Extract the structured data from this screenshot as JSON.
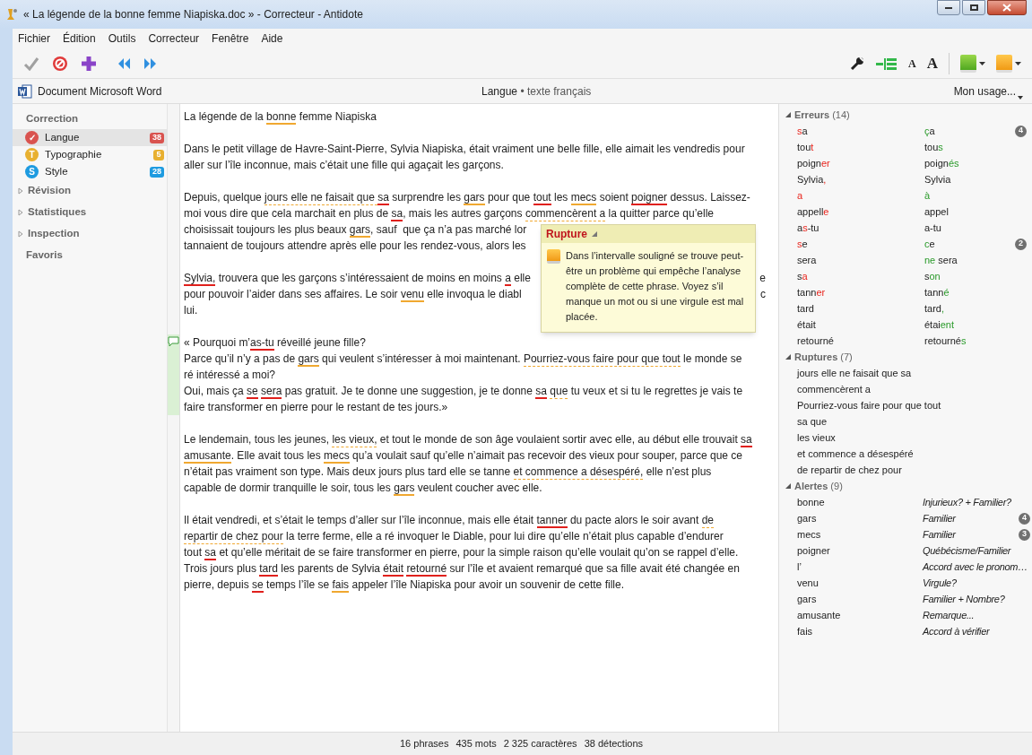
{
  "window": {
    "title": "« La légende de la bonne femme Niapiska.doc » - Correcteur - Antidote"
  },
  "menu": [
    {
      "label": "Fichier"
    },
    {
      "label": "Édition"
    },
    {
      "label": "Outils"
    },
    {
      "label": "Correcteur"
    },
    {
      "label": "Fenêtre"
    },
    {
      "label": "Aide"
    }
  ],
  "toolbar": {
    "font_buttons": [
      "A",
      "A"
    ]
  },
  "doc_bar": {
    "document": "Document Microsoft Word",
    "prism": "Langue",
    "separator": "•",
    "language": "texte français",
    "usage": "Mon usage..."
  },
  "sidebar": [
    {
      "label": "Correction",
      "kind": "group",
      "items": [
        {
          "label": "Langue",
          "symbol": "✓",
          "count": "38",
          "color": "#d9534f",
          "selected": true
        },
        {
          "label": "Typographie",
          "symbol": "T",
          "count": "5",
          "color": "#e8b030",
          "selected": false
        },
        {
          "label": "Style",
          "symbol": "S",
          "count": "28",
          "color": "#1e9be0",
          "selected": false
        }
      ]
    },
    {
      "label": "Révision",
      "kind": "collapsible",
      "expanded": false
    },
    {
      "label": "Statistiques",
      "kind": "collapsible",
      "expanded": false
    },
    {
      "label": "Inspection",
      "kind": "collapsible",
      "expanded": false
    },
    {
      "label": "Favoris",
      "kind": "plain"
    }
  ],
  "document": {
    "paragraphs": [
      {
        "comment": false,
        "lines": [
          [
            {
              "text": "La légende de la ",
              "kind": "plain"
            },
            {
              "text": "bonne",
              "kind": "alert"
            },
            {
              "text": " femme Niapiska",
              "kind": "plain"
            }
          ]
        ]
      },
      {
        "comment": false,
        "lines": [
          [
            {
              "text": "Dans le petit village de Havre-Saint-Pierre, Sylvia Niapiska, était vraiment une belle fille, elle aimait les vendredis pour",
              "kind": "plain"
            }
          ],
          [
            {
              "text": "aller sur l’île inconnue, mais c’était une fille qui agaçait les garçons.",
              "kind": "plain"
            }
          ]
        ]
      },
      {
        "comment": false,
        "lines": [
          [
            {
              "text": "Depuis, quelque ",
              "kind": "plain"
            },
            {
              "text": "jours elle ne faisait que ",
              "kind": "rupture"
            },
            {
              "text": "sa",
              "kind": "rupture_error"
            },
            {
              "text": " surprendre les ",
              "kind": "plain"
            },
            {
              "text": "gars",
              "kind": "alert"
            },
            {
              "text": " pour que ",
              "kind": "plain"
            },
            {
              "text": "tout",
              "kind": "error"
            },
            {
              "text": " les ",
              "kind": "plain"
            },
            {
              "text": "mecs",
              "kind": "alert"
            },
            {
              "text": " soient ",
              "kind": "plain"
            },
            {
              "text": "poigner",
              "kind": "error"
            },
            {
              "text": " dessus. Laissez-",
              "kind": "plain"
            }
          ],
          [
            {
              "text": "moi vous dire que cela marchait en plus de ",
              "kind": "plain"
            },
            {
              "text": "sa",
              "kind": "error"
            },
            {
              "text": ", mais les autres garçons ",
              "kind": "plain"
            },
            {
              "text": "commencèrent a",
              "kind": "rupture"
            },
            {
              "text": " la quitter parce qu’elle",
              "kind": "plain"
            }
          ],
          [
            {
              "text": "choisissait toujours les plus beaux ",
              "kind": "plain"
            },
            {
              "text": "gars",
              "kind": "alert"
            },
            {
              "text": ", sauf  que ça n’a pas marché lor",
              "kind": "plain"
            }
          ],
          [
            {
              "text": "tannaient de toujours attendre après elle pour les rendez-vous, alors les",
              "kind": "plain"
            }
          ]
        ]
      },
      {
        "comment": false,
        "lines": [
          [
            {
              "text": "Sylvia,",
              "kind": "error"
            },
            {
              "text": " trouvera que les garçons s’intéressaient de moins en moins ",
              "kind": "plain"
            },
            {
              "text": "a",
              "kind": "error"
            },
            {
              "text": " elle",
              "kind": "plain"
            },
            {
              "text": "e",
              "kind": "tail"
            }
          ],
          [
            {
              "text": "pour pouvoir l’aider dans ses affaires. Le soir ",
              "kind": "plain"
            },
            {
              "text": "venu",
              "kind": "alert"
            },
            {
              "text": " elle invoqua le diabl",
              "kind": "plain"
            },
            {
              "text": "c",
              "kind": "tail"
            }
          ],
          [
            {
              "text": "lui.",
              "kind": "plain"
            }
          ]
        ]
      },
      {
        "comment": true,
        "lines": [
          [
            {
              "text": "« Pourquoi m’",
              "kind": "plain"
            },
            {
              "text": "as-tu",
              "kind": "error"
            },
            {
              "text": " réveillé jeune fille?",
              "kind": "plain"
            }
          ],
          [
            {
              "text": "Parce qu’il n’y a pas de ",
              "kind": "plain"
            },
            {
              "text": "gars",
              "kind": "alert"
            },
            {
              "text": " qui veulent s’intéresser à moi maintenant. ",
              "kind": "plain"
            },
            {
              "text": "Pourriez-vous faire pour que tout",
              "kind": "rupture"
            },
            {
              "text": " le monde se",
              "kind": "plain"
            }
          ],
          [
            {
              "text": "ré intéressé a moi?",
              "kind": "plain"
            }
          ],
          [
            {
              "text": "Oui, mais ça ",
              "kind": "plain"
            },
            {
              "text": "se",
              "kind": "error"
            },
            {
              "text": " sera",
              "kind": "error"
            },
            {
              "text": " pas gratuit. Je te donne une suggestion, je te donne ",
              "kind": "plain"
            },
            {
              "text": "sa",
              "kind": "rupture_error"
            },
            {
              "text": " que",
              "kind": "rupture"
            },
            {
              "text": " tu veux et si tu le regrettes je vais te",
              "kind": "plain"
            }
          ],
          [
            {
              "text": "faire transformer en pierre pour le restant de tes jours.»",
              "kind": "plain"
            }
          ]
        ]
      },
      {
        "comment": false,
        "lines": [
          [
            {
              "text": "Le lendemain, tous les jeunes, ",
              "kind": "plain"
            },
            {
              "text": "les vieux,",
              "kind": "rupture"
            },
            {
              "text": " et tout le monde de son âge voulaient sortir avec elle, au début elle trouvait ",
              "kind": "plain"
            },
            {
              "text": "sa",
              "kind": "error"
            }
          ],
          [
            {
              "text": "amusante",
              "kind": "alert"
            },
            {
              "text": ". Elle avait tous les ",
              "kind": "plain"
            },
            {
              "text": "mecs",
              "kind": "alert"
            },
            {
              "text": " qu’a voulait sauf qu’elle n’aimait pas recevoir des vieux pour souper, parce que ce",
              "kind": "plain"
            }
          ],
          [
            {
              "text": "n’était pas vraiment son type. Mais deux jours plus tard elle se tanne ",
              "kind": "plain"
            },
            {
              "text": "et commence a désespéré,",
              "kind": "rupture"
            },
            {
              "text": " elle n’est plus",
              "kind": "plain"
            }
          ],
          [
            {
              "text": "capable de dormir tranquille le soir, tous les ",
              "kind": "plain"
            },
            {
              "text": "gars",
              "kind": "alert"
            },
            {
              "text": " veulent coucher avec elle.",
              "kind": "plain"
            }
          ]
        ]
      },
      {
        "comment": false,
        "lines": [
          [
            {
              "text": "Il était vendredi, et s’était le temps d’aller sur l’île inconnue, mais elle était ",
              "kind": "plain"
            },
            {
              "text": "tanner",
              "kind": "error"
            },
            {
              "text": " du pacte alors le soir avant ",
              "kind": "plain"
            },
            {
              "text": "de",
              "kind": "rupture"
            }
          ],
          [
            {
              "text": "repartir de chez pour",
              "kind": "rupture"
            },
            {
              "text": " la terre ferme, elle a ré invoquer le Diable, pour lui dire qu’elle n’était plus capable d’endurer",
              "kind": "plain"
            }
          ],
          [
            {
              "text": "tout ",
              "kind": "plain"
            },
            {
              "text": "sa",
              "kind": "error"
            },
            {
              "text": " et qu’elle méritait de se faire transformer en pierre, pour la simple raison qu’elle voulait qu’on se rappel d’elle.",
              "kind": "plain"
            }
          ],
          [
            {
              "text": "Trois jours plus ",
              "kind": "plain"
            },
            {
              "text": "tard",
              "kind": "error"
            },
            {
              "text": " les parents de Sylvia ",
              "kind": "plain"
            },
            {
              "text": "était",
              "kind": "error"
            },
            {
              "text": " retourné",
              "kind": "error"
            },
            {
              "text": " sur l’île et avaient remarqué que sa fille avait été changée en",
              "kind": "plain"
            }
          ],
          [
            {
              "text": "pierre, depuis ",
              "kind": "plain"
            },
            {
              "text": "se",
              "kind": "error"
            },
            {
              "text": " temps l’île se ",
              "kind": "plain"
            },
            {
              "text": "fais",
              "kind": "alert"
            },
            {
              "text": " appeler l’île Niapiska pour avoir un souvenir de cette fille.",
              "kind": "plain"
            }
          ]
        ]
      }
    ]
  },
  "popup": {
    "title": "Rupture",
    "text": "Dans l’intervalle souligné se trouve peut-être un problème qui empêche l’analyse complète de cette phrase. Voyez s’il manque un mot ou si une virgule est mal placée."
  },
  "panel": {
    "sections": [
      {
        "kind": "errors",
        "title": "Erreurs",
        "count": "(14)",
        "expanded": true,
        "items": [
          {
            "wrong": [
              {
                "text": "s",
                "changed": true
              },
              {
                "text": "a",
                "changed": false
              }
            ],
            "fix": [
              {
                "text": "ç",
                "changed": true
              },
              {
                "text": "a",
                "changed": false
              }
            ],
            "count": "4"
          },
          {
            "wrong": [
              {
                "text": "tou",
                "changed": false
              },
              {
                "text": "t",
                "changed": true
              }
            ],
            "fix": [
              {
                "text": "tou",
                "changed": false
              },
              {
                "text": "s",
                "changed": true
              }
            ]
          },
          {
            "wrong": [
              {
                "text": "poign",
                "changed": false
              },
              {
                "text": "er",
                "changed": true
              }
            ],
            "fix": [
              {
                "text": "poign",
                "changed": false
              },
              {
                "text": "és",
                "changed": true
              }
            ]
          },
          {
            "wrong": [
              {
                "text": "Sylvia",
                "changed": false
              },
              {
                "text": ",",
                "changed": true
              }
            ],
            "fix": [
              {
                "text": "Sylvia",
                "changed": false
              }
            ]
          },
          {
            "wrong": [
              {
                "text": "a",
                "changed": true
              }
            ],
            "fix": [
              {
                "text": "à",
                "changed": true
              }
            ]
          },
          {
            "wrong": [
              {
                "text": "appell",
                "changed": false
              },
              {
                "text": "e",
                "changed": true
              }
            ],
            "fix": [
              {
                "text": "appel",
                "changed": false
              }
            ]
          },
          {
            "wrong": [
              {
                "text": "a",
                "changed": false
              },
              {
                "text": "s",
                "changed": true
              },
              {
                "text": "-tu",
                "changed": false
              }
            ],
            "fix": [
              {
                "text": "a-tu",
                "changed": false
              }
            ]
          },
          {
            "wrong": [
              {
                "text": "s",
                "changed": true
              },
              {
                "text": "e",
                "changed": false
              }
            ],
            "fix": [
              {
                "text": "c",
                "changed": true
              },
              {
                "text": "e",
                "changed": false
              }
            ],
            "count": "2"
          },
          {
            "wrong": [
              {
                "text": "sera",
                "changed": false
              }
            ],
            "fix": [
              {
                "text": "ne",
                "changed": true
              },
              {
                "text": " sera",
                "changed": false
              }
            ]
          },
          {
            "wrong": [
              {
                "text": "s",
                "changed": false
              },
              {
                "text": "a",
                "changed": true
              }
            ],
            "fix": [
              {
                "text": "s",
                "changed": false
              },
              {
                "text": "on",
                "changed": true
              }
            ]
          },
          {
            "wrong": [
              {
                "text": "tann",
                "changed": false
              },
              {
                "text": "er",
                "changed": true
              }
            ],
            "fix": [
              {
                "text": "tann",
                "changed": false
              },
              {
                "text": "é",
                "changed": true
              }
            ]
          },
          {
            "wrong": [
              {
                "text": "tard",
                "changed": false
              }
            ],
            "fix": [
              {
                "text": "tard",
                "changed": false
              },
              {
                "text": ",",
                "changed": true
              }
            ]
          },
          {
            "wrong": [
              {
                "text": "était",
                "changed": false
              }
            ],
            "fix": [
              {
                "text": "étai",
                "changed": false
              },
              {
                "text": "ent",
                "changed": true
              }
            ]
          },
          {
            "wrong": [
              {
                "text": "retourné",
                "changed": false
              }
            ],
            "fix": [
              {
                "text": "retourné",
                "changed": false
              },
              {
                "text": "s",
                "changed": true
              }
            ]
          }
        ]
      },
      {
        "kind": "ruptures",
        "title": "Ruptures",
        "count": "(7)",
        "expanded": true,
        "items": [
          {
            "text": "jours elle ne faisait que sa"
          },
          {
            "text": "commencèrent a"
          },
          {
            "text": "Pourriez-vous faire pour que tout"
          },
          {
            "text": "sa que"
          },
          {
            "text": "les vieux"
          },
          {
            "text": "et commence a désespéré"
          },
          {
            "text": "de repartir de chez pour"
          }
        ]
      },
      {
        "kind": "alerts",
        "title": "Alertes",
        "count": "(9)",
        "expanded": true,
        "items": [
          {
            "word": "bonne",
            "note": "Injurieux? + Familier?"
          },
          {
            "word": "gars",
            "note": "Familier",
            "count": "4"
          },
          {
            "word": "mecs",
            "note": "Familier",
            "count": "3"
          },
          {
            "word": "poigner",
            "note": "Québécisme/Familier"
          },
          {
            "word": "l’",
            "note": "Accord avec le pronom…"
          },
          {
            "word": "venu",
            "note": "Virgule?"
          },
          {
            "word": "gars",
            "note": "Familier + Nombre?"
          },
          {
            "word": "amusante",
            "note": "Remarque..."
          },
          {
            "word": "fais",
            "note": "Accord à vérifier"
          }
        ]
      }
    ]
  },
  "status_bar": [
    "16 phrases",
    "435 mots",
    "2 325 caractères",
    "38 détections"
  ]
}
